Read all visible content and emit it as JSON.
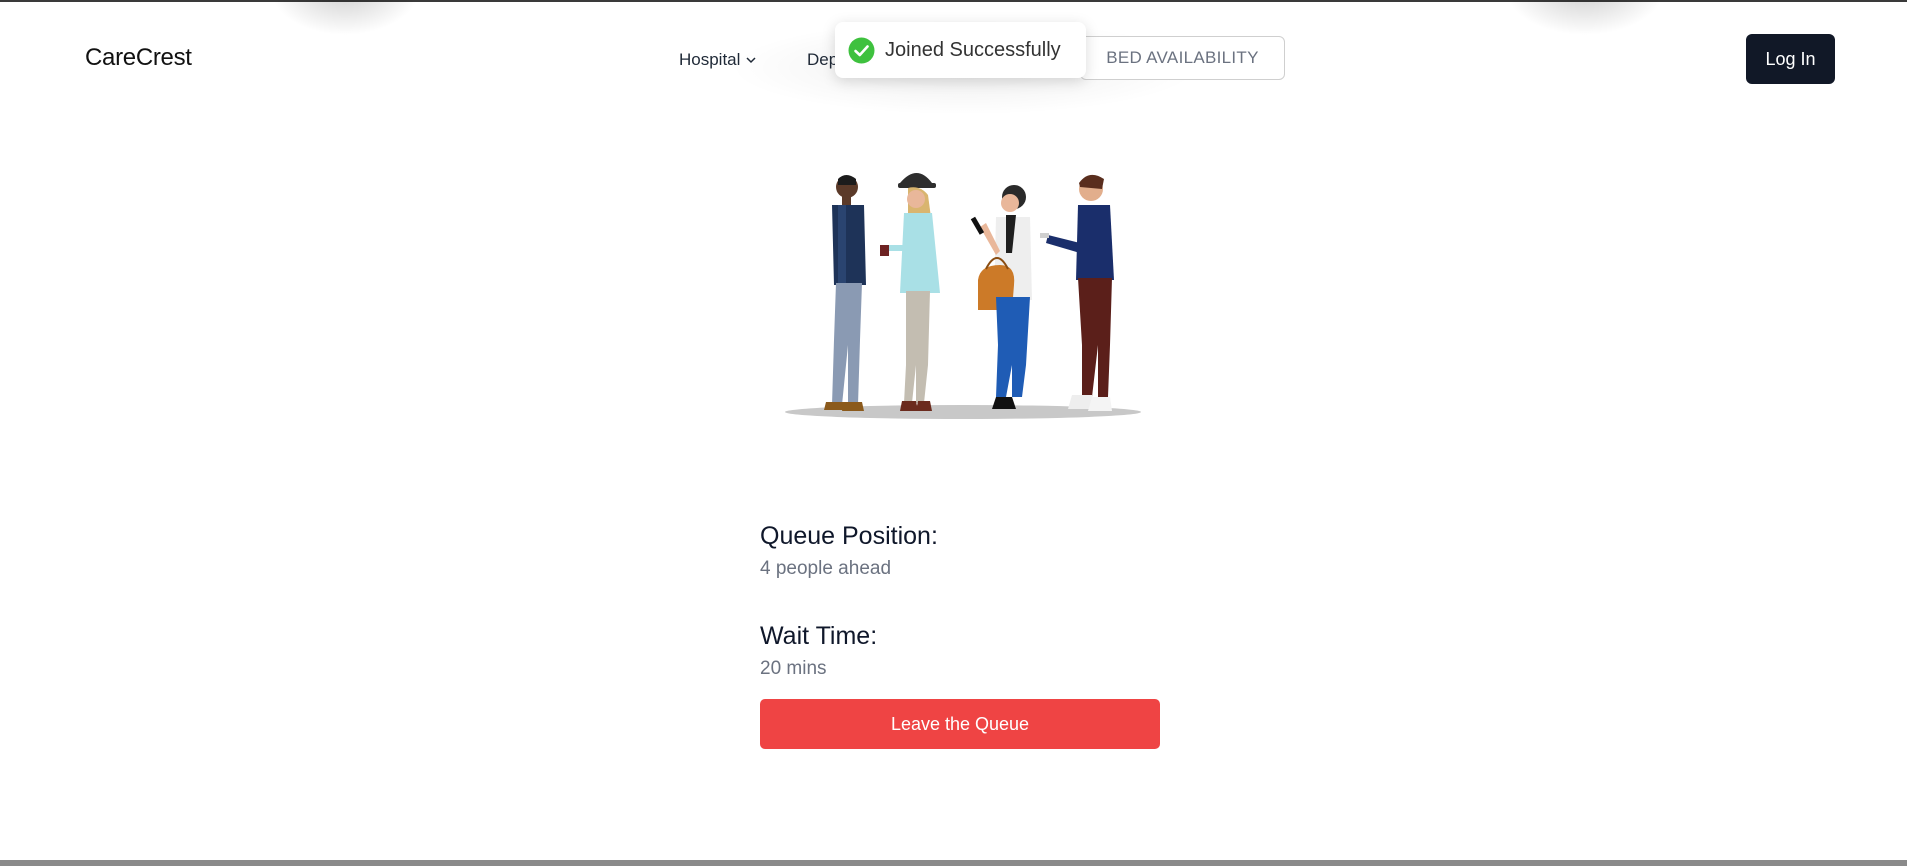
{
  "brand": {
    "name": "CareCrest"
  },
  "nav": {
    "hospital_label": "Hospital",
    "departments_label": "Dep",
    "bed_availability_label": "BED AVAILABILITY",
    "login_label": "Log In"
  },
  "toast": {
    "message": "Joined Successfully",
    "icon": "check-circle-icon",
    "color": "#3ec13e"
  },
  "queue": {
    "position_title": "Queue Position:",
    "position_value": "4 people ahead",
    "wait_title": "Wait Time:",
    "wait_value": "20 mins",
    "leave_label": "Leave the Queue"
  },
  "illustration": {
    "name": "people-in-queue-illustration",
    "person_count": 4
  },
  "colors": {
    "primary_dark": "#111827",
    "danger": "#ef4444",
    "success": "#3ec13e"
  }
}
